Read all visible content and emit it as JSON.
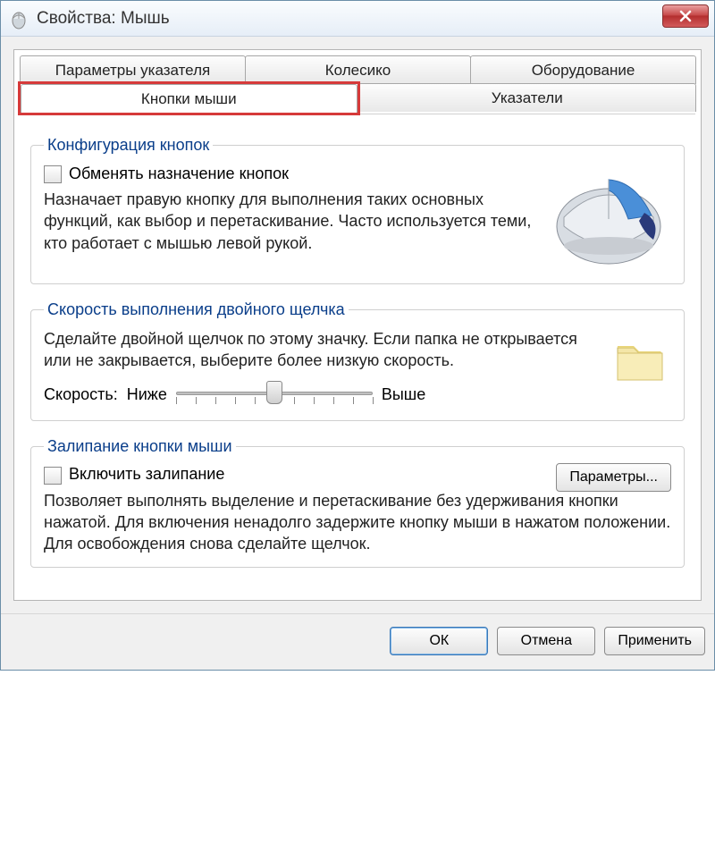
{
  "window": {
    "title": "Свойства: Мышь"
  },
  "tabs": {
    "row1": [
      "Параметры указателя",
      "Колесико",
      "Оборудование"
    ],
    "row2": [
      "Кнопки мыши",
      "Указатели"
    ],
    "active": "Кнопки мыши"
  },
  "group1": {
    "legend": "Конфигурация кнопок",
    "checkbox_label": "Обменять назначение кнопок",
    "checked": false,
    "description": "Назначает правую кнопку для выполнения таких основных функций, как выбор и перетаскивание. Часто используется теми, кто работает с мышью левой рукой."
  },
  "group2": {
    "legend": "Скорость выполнения двойного щелчка",
    "description": "Сделайте двойной щелчок по этому значку. Если папка не открывается или не закрывается, выберите более низкую скорость.",
    "speed_label": "Скорость:",
    "low_label": "Ниже",
    "high_label": "Выше",
    "slider_value": 5,
    "slider_max": 10
  },
  "group3": {
    "legend": "Залипание кнопки мыши",
    "checkbox_label": "Включить залипание",
    "checked": false,
    "settings_button": "Параметры...",
    "description": "Позволяет выполнять выделение и перетаскивание без удерживания кнопки нажатой. Для включения ненадолго задержите кнопку мыши в нажатом положении. Для освобождения снова сделайте щелчок."
  },
  "footer": {
    "ok": "ОК",
    "cancel": "Отмена",
    "apply": "Применить"
  }
}
